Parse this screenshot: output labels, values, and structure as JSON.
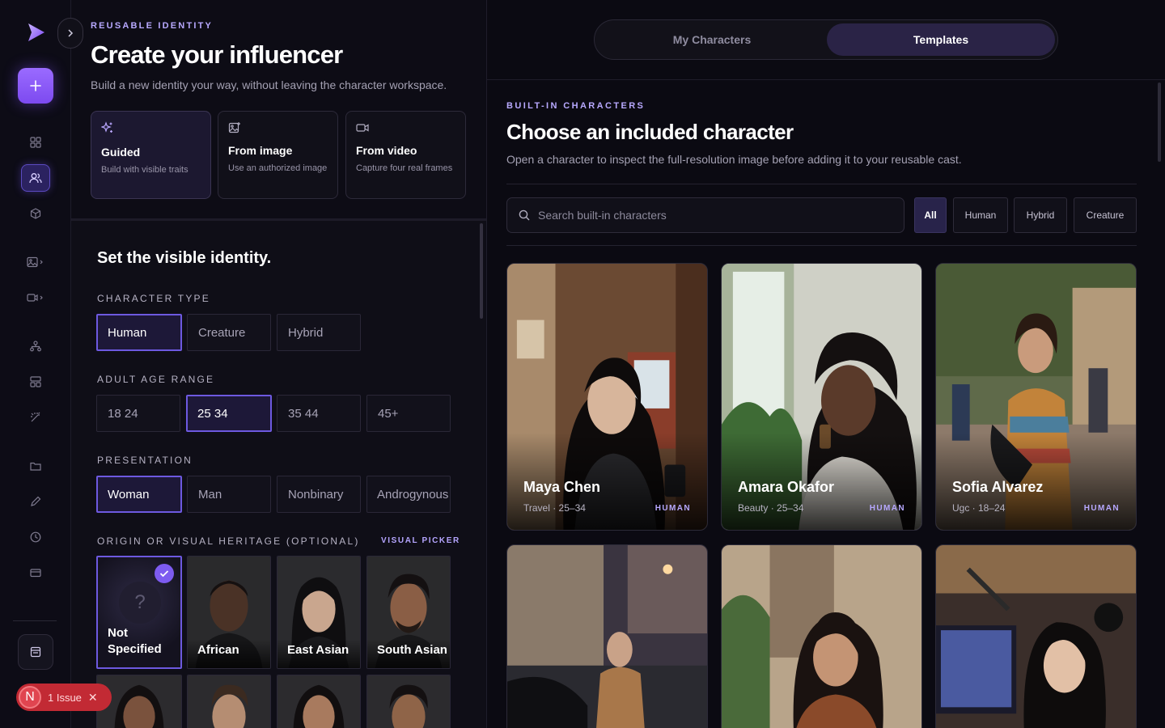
{
  "left": {
    "eyebrow": "REUSABLE IDENTITY",
    "title": "Create your influencer",
    "subtitle": "Build a new identity your way, without leaving the character workspace.",
    "methods": [
      {
        "title": "Guided",
        "desc": "Build with visible traits",
        "icon": "sparkle-icon"
      },
      {
        "title": "From image",
        "desc": "Use an authorized image",
        "icon": "image-plus-icon"
      },
      {
        "title": "From video",
        "desc": "Capture four real frames",
        "icon": "video-icon"
      }
    ],
    "form": {
      "heading": "Set the visible identity.",
      "character_type": {
        "label": "CHARACTER TYPE",
        "options": [
          "Human",
          "Creature",
          "Hybrid"
        ],
        "selected": "Human"
      },
      "age": {
        "label": "ADULT AGE RANGE",
        "options": [
          "18 24",
          "25 34",
          "35 44",
          "45+"
        ],
        "selected": "25 34"
      },
      "presentation": {
        "label": "PRESENTATION",
        "options": [
          "Woman",
          "Man",
          "Nonbinary",
          "Androgynous"
        ],
        "selected": "Woman"
      },
      "heritage": {
        "label": "ORIGIN OR VISUAL HERITAGE (OPTIONAL)",
        "picker_label": "VISUAL PICKER",
        "options": [
          "Not Specified",
          "African",
          "East Asian",
          "South Asian"
        ],
        "selected": "Not Specified",
        "placeholder_glyph": "?"
      }
    }
  },
  "issue": {
    "avatar_letter": "N",
    "text": "1 Issue"
  },
  "right": {
    "tabs": [
      "My Characters",
      "Templates"
    ],
    "active_tab": "Templates",
    "eyebrow": "BUILT-IN CHARACTERS",
    "title": "Choose an included character",
    "subtitle": "Open a character to inspect the full-resolution image before adding it to your reusable cast.",
    "search_placeholder": "Search built-in characters",
    "filters": [
      "All",
      "Human",
      "Hybrid",
      "Creature"
    ],
    "active_filter": "All",
    "cards": [
      {
        "name": "Maya Chen",
        "meta": "Travel · 25–34",
        "tag": "HUMAN"
      },
      {
        "name": "Amara Okafor",
        "meta": "Beauty · 25–34",
        "tag": "HUMAN"
      },
      {
        "name": "Sofia Alvarez",
        "meta": "Ugc · 18–24",
        "tag": "HUMAN"
      },
      {
        "name": "",
        "meta": "",
        "tag": ""
      },
      {
        "name": "",
        "meta": "",
        "tag": ""
      },
      {
        "name": "",
        "meta": "",
        "tag": ""
      }
    ]
  },
  "colors": {
    "accent": "#7d4af0",
    "selected_border": "#6d59e0",
    "eyebrow": "#b8a9ff",
    "issue_red": "#c22a34"
  }
}
